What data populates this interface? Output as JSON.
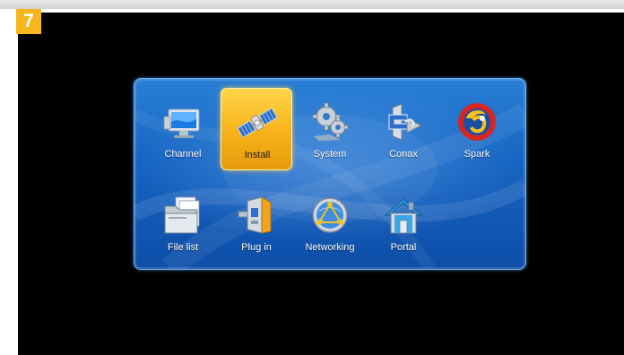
{
  "step_badge": "7",
  "menu": {
    "items": [
      {
        "label": "Channel",
        "icon": "monitor-icon",
        "selected": false
      },
      {
        "label": "Install",
        "icon": "satellite-icon",
        "selected": true
      },
      {
        "label": "System",
        "icon": "gears-icon",
        "selected": false
      },
      {
        "label": "Conax",
        "icon": "conax-icon",
        "selected": false
      },
      {
        "label": "Spark",
        "icon": "spark-logo-icon",
        "selected": false
      },
      {
        "label": "File list",
        "icon": "folder-icon",
        "selected": false
      },
      {
        "label": "Plug in",
        "icon": "plugin-icon",
        "selected": false
      },
      {
        "label": "Networking",
        "icon": "network-globe-icon",
        "selected": false
      },
      {
        "label": "Portal",
        "icon": "house-icon",
        "selected": false
      }
    ]
  },
  "colors": {
    "panel": "#1664c2",
    "selected_tile": "#f7b21a",
    "screen_background": "#000000",
    "badge": "#f7b61c"
  }
}
